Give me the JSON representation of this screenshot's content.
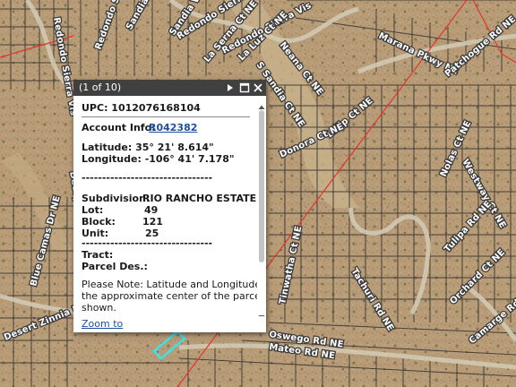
{
  "map": {
    "street_labels": [
      "Redondo Sierra Vis",
      "Redondo Sierra Vis NE",
      "Redondo Sierra Vis",
      "Redondo Sierra Vis",
      "La Luz Ct NE",
      "Sandia Vis NE",
      "Sandia Vis",
      "Neana Ct NE",
      "La Serna Ct NE",
      "S Sandia Ct NE",
      "Marana Pkwy NE",
      "Patchogue Rd NE",
      "Lalip Ct NE",
      "Nolas Ct NE",
      "Westway Ct NE",
      "Donora Ct NE",
      "Tinwatha Ct NE",
      "Tachuri Rd NE",
      "Orchard Ct NE",
      "Tulipa Rd NE",
      "Oswego Rd NE",
      "Mateo Rd NE",
      "Camarge Rd NE",
      "Blue Camas Dr NE",
      "Desert Zinnia Rd NE",
      "Decoy Dr NE"
    ],
    "colors": {
      "ground": "#b89c78",
      "arroyo": "#c9b48c",
      "parcel_line": "#2f2f2f",
      "boundary": "#e4342c",
      "selected_parcel": "#3fe0e8"
    }
  },
  "popup": {
    "counter": "(1 of 10)",
    "next_icon": "play-next-icon",
    "maximize_icon": "maximize-icon",
    "close_icon": "close-icon",
    "upc": "UPC: 1012076168104",
    "account_info_label": "Account Info:",
    "account_info_value": "R042382",
    "latitude": "Latitude: 35° 21' 8.614\"",
    "longitude": "Longitude: -106° 41' 7.178\"",
    "divider1": "--------------------------------",
    "subdivision_label": "Subdivision:",
    "subdivision_value": "RIO RANCHO ESTATES",
    "lot_label": "Lot:",
    "lot_value": "49",
    "block_label": "Block:",
    "block_value": "121",
    "unit_label": "Unit:",
    "unit_value": "25",
    "divider2": "--------------------------------",
    "tract_label": "Tract:",
    "parcel_des_label": "Parcel Des.:",
    "note": [
      "Please Note: Latitude and Longitude is",
      "the approximate center of the parcel",
      "shown."
    ],
    "zoom_link": "Zoom to"
  }
}
